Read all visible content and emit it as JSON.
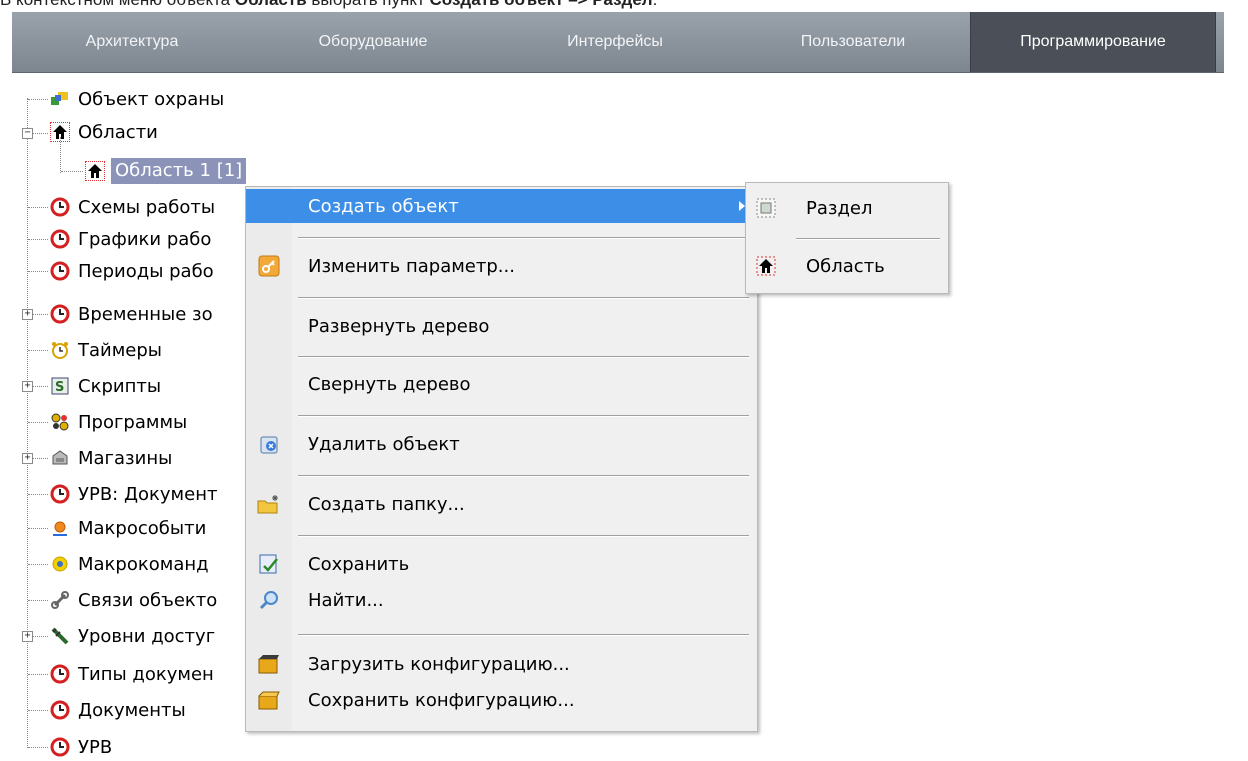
{
  "caption": {
    "prefix": "В контекстном меню объекта ",
    "object": "Область",
    "middle": " выбрать пункт ",
    "item": "Создать объект –> Раздел",
    "suffix": "."
  },
  "tabs": [
    {
      "label": "Архитектура"
    },
    {
      "label": "Оборудование"
    },
    {
      "label": "Интерфейсы"
    },
    {
      "label": "Пользователи"
    },
    {
      "label": "Программирование",
      "active": true
    }
  ],
  "tree": {
    "items": [
      {
        "label": "Объект охраны",
        "icon": "security-object-icon"
      },
      {
        "label": "Области",
        "icon": "home-icon",
        "expanded": true
      },
      {
        "label": "Область 1 [1]",
        "icon": "home-icon",
        "selected": true
      },
      {
        "label": "Схемы работы",
        "icon": "clock-icon"
      },
      {
        "label": "Графики рабо",
        "icon": "clock-icon"
      },
      {
        "label": "Периоды рабо",
        "icon": "clock-icon"
      },
      {
        "label": "Временные зо",
        "icon": "clock-icon",
        "collapsed": true
      },
      {
        "label": "Таймеры",
        "icon": "alarm-clock-icon"
      },
      {
        "label": "Скрипты",
        "icon": "script-icon",
        "collapsed": true
      },
      {
        "label": "Программы",
        "icon": "program-icon"
      },
      {
        "label": "Магазины",
        "icon": "shop-icon",
        "collapsed": true
      },
      {
        "label": "УРВ: Документ",
        "icon": "clock-icon"
      },
      {
        "label": "Макрособыти",
        "icon": "macro-event-icon"
      },
      {
        "label": "Макрокоманд",
        "icon": "macro-command-icon"
      },
      {
        "label": "Связи объекто",
        "icon": "link-icon"
      },
      {
        "label": "Уровни достуг",
        "icon": "access-level-icon",
        "collapsed": true
      },
      {
        "label": "Типы докумен",
        "icon": "clock-icon"
      },
      {
        "label": "Документы",
        "icon": "clock-icon"
      },
      {
        "label": "УРВ",
        "icon": "clock-icon"
      }
    ]
  },
  "context_menu": {
    "items": [
      {
        "label": "Создать объект",
        "highlighted": true,
        "has_submenu": true
      },
      {
        "label": "Изменить параметр...",
        "icon": "key-icon"
      },
      {
        "label": "Развернуть дерево"
      },
      {
        "label": "Свернуть дерево"
      },
      {
        "label": "Удалить объект",
        "icon": "delete-object-icon"
      },
      {
        "label": "Создать папку...",
        "icon": "new-folder-icon"
      },
      {
        "label": "Сохранить",
        "icon": "save-icon"
      },
      {
        "label": "Найти...",
        "icon": "search-icon"
      },
      {
        "label": "Загрузить конфигурацию...",
        "icon": "load-config-icon"
      },
      {
        "label": "Сохранить конфигурацию...",
        "icon": "save-config-icon"
      }
    ]
  },
  "submenu": {
    "items": [
      {
        "label": "Раздел",
        "icon": "section-icon"
      },
      {
        "label": "Область",
        "icon": "home-icon"
      }
    ]
  },
  "colors": {
    "highlight": "#3c8ee6",
    "selection": "#8b93b8",
    "tabbar": "#8a929c",
    "tab_active": "#4b5058",
    "clock_red": "#d42020"
  }
}
